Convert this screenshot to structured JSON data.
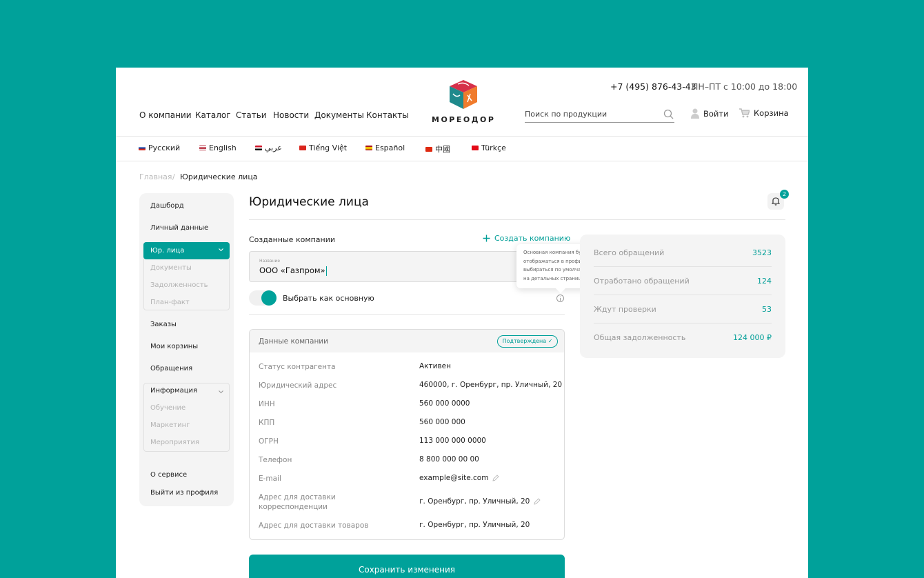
{
  "header": {
    "nav": [
      "О компании",
      "Каталог",
      "Статьи",
      "Новости",
      "Документы",
      "Контакты"
    ],
    "phone": "+7 (495) 876-43-43",
    "hours": "ПН–ПТ с 10:00 до 18:00",
    "logo_text": "МОРЕОДОР",
    "search_placeholder": "Поиск по продукции",
    "login": "Войти",
    "cart": "Корзина"
  },
  "languages": [
    {
      "label": "Русский",
      "flag": "#d52b1e"
    },
    {
      "label": "English",
      "flag": "#3c3b6e"
    },
    {
      "label": "عربي",
      "flag": "#ce1126"
    },
    {
      "label": "Tiếng Việt",
      "flag": "#da251d"
    },
    {
      "label": "Español",
      "flag": "#f1bf00"
    },
    {
      "label": "中國",
      "flag": "#de2910"
    },
    {
      "label": "Türkçe",
      "flag": "#e30a17"
    }
  ],
  "breadcrumb": {
    "home": "Главная",
    "separator": "/",
    "current": "Юридические лица"
  },
  "sidebar": {
    "dashboard": "Дашборд",
    "personal": "Личный данные",
    "legal": "Юр. лица",
    "legal_sub": [
      "Документы",
      "Задолженность",
      "План-факт"
    ],
    "orders": "Заказы",
    "carts": "Мои корзины",
    "requests": "Обращения",
    "info": "Информация",
    "info_sub": [
      "Обучение",
      "Маркетинг",
      "Мероприятия"
    ],
    "about": "О сервисе",
    "logout": "Выйти из профиля"
  },
  "main": {
    "title": "Юридические лица",
    "notifications_count": "2",
    "created_label": "Созданные компании",
    "create_button": "Создать компанию",
    "field_label": "Название",
    "company_name": "ООО «Газпром»",
    "tooltip": "Основная компания будет отображаться в профиле и выбираться по умолчанию на детальных страницах",
    "toggle_label": "Выбрать как основную",
    "toggle_on": true
  },
  "company": {
    "title": "Данные компании",
    "status_badge": "Подтверждена",
    "rows": [
      {
        "k": "Статус контрагента",
        "v": "Активен"
      },
      {
        "k": "Юридический адрес",
        "v": "460000, г. Оренбург, пр. Уличный, 20"
      },
      {
        "k": "ИНН",
        "v": "560 000 0000"
      },
      {
        "k": "КПП",
        "v": "560 000 000"
      },
      {
        "k": "ОГРН",
        "v": "113 000 000 0000"
      },
      {
        "k": "Телефон",
        "v": "8 800 000 00 00"
      },
      {
        "k": "E-mail",
        "v": "example@site.com"
      },
      {
        "k": "Адрес для доставки корреспонденции",
        "v": "г. Оренбург, пр. Уличный, 20"
      },
      {
        "k": "Адрес для доставки товаров",
        "v": "г. Оренбург, пр. Уличный, 20"
      }
    ]
  },
  "save_button": "Сохранить изменения",
  "stats": [
    {
      "k": "Всего обращений",
      "v": "3523"
    },
    {
      "k": "Отработано обращений",
      "v": "124"
    },
    {
      "k": "Ждут проверки",
      "v": "53"
    },
    {
      "k": "Общая задолженность",
      "v": "124 000 ₽"
    }
  ],
  "colors": {
    "accent": "#00a19a",
    "background": "#00a19a"
  }
}
